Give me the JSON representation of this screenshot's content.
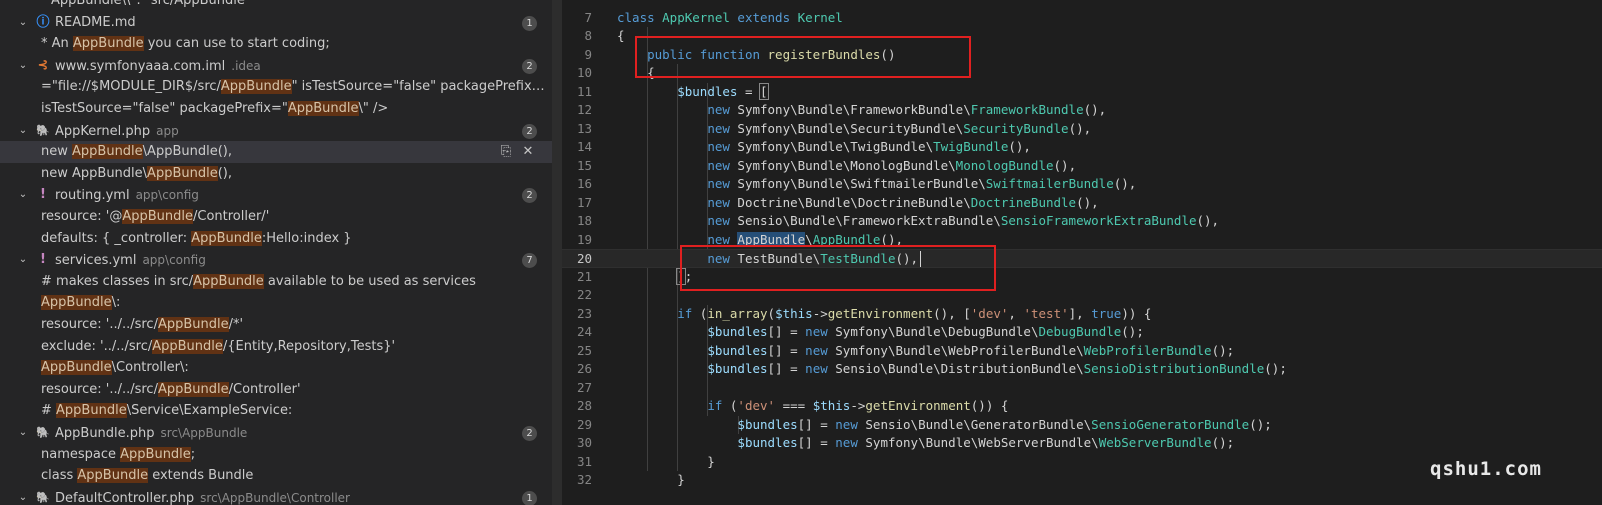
{
  "search_results": {
    "header_line": "\"AppBundle\\\\\": \"src/AppBundle",
    "files": [
      {
        "name": "README.md",
        "path": "",
        "count": "1",
        "icon": "info-icon",
        "icon_glyph": "ⓘ",
        "icon_color": "#3794ff",
        "matches": [
          [
            "* An ",
            "AppBundle",
            " you can use to start coding;"
          ]
        ]
      },
      {
        "name": "www.symfonyaaa.com.iml",
        "path": ".idea",
        "count": "2",
        "icon": "rss-icon",
        "icon_glyph": "⊰",
        "icon_color": "#e37933",
        "matches": [
          [
            "=\"file://$MODULE_DIR$/src/",
            "AppBundle",
            "\" isTestSource=\"false\" packagePrefix=\"AppBundle..."
          ],
          [
            "isTestSource=\"false\" packagePrefix=\"",
            "AppBundle",
            "\\\" />"
          ]
        ]
      },
      {
        "name": "AppKernel.php",
        "path": "app",
        "count": "2",
        "icon": "php-elephant-icon",
        "icon_glyph": "🐘",
        "icon_color": "#a074c4",
        "matches": [
          [
            "new ",
            "AppBundle",
            "\\AppBundle(),"
          ],
          [
            "new AppBundle\\",
            "AppBundle",
            "(),"
          ]
        ]
      },
      {
        "name": "routing.yml",
        "path": "app\\config",
        "count": "2",
        "icon": "yaml-icon",
        "icon_glyph": "!",
        "icon_color": "#c586c0",
        "matches": [
          [
            "resource: '@",
            "AppBundle",
            "/Controller/'"
          ],
          [
            "defaults:  { _controller: ",
            "AppBundle",
            ":Hello:index }"
          ]
        ]
      },
      {
        "name": "services.yml",
        "path": "app\\config",
        "count": "7",
        "icon": "yaml-icon",
        "icon_glyph": "!",
        "icon_color": "#c586c0",
        "matches": [
          [
            "# makes classes in src/",
            "AppBundle",
            " available to be used as services"
          ],
          [
            "",
            "AppBundle",
            "\\:"
          ],
          [
            "resource: '../../src/",
            "AppBundle",
            "/*'"
          ],
          [
            "exclude: '../../src/",
            "AppBundle",
            "/{Entity,Repository,Tests}'"
          ],
          [
            "",
            "AppBundle",
            "\\Controller\\:"
          ],
          [
            "resource: '../../src/",
            "AppBundle",
            "/Controller'"
          ],
          [
            "# ",
            "AppBundle",
            "\\Service\\ExampleService:"
          ]
        ]
      },
      {
        "name": "AppBundle.php",
        "path": "src\\AppBundle",
        "count": "2",
        "icon": "php-elephant-icon",
        "icon_glyph": "🐘",
        "icon_color": "#a074c4",
        "matches": [
          [
            "namespace ",
            "AppBundle",
            ";"
          ],
          [
            "class ",
            "AppBundle",
            " extends Bundle"
          ]
        ]
      },
      {
        "name": "DefaultController.php",
        "path": "src\\AppBundle\\Controller",
        "count": "1",
        "icon": "php-elephant-icon",
        "icon_glyph": "🐘",
        "icon_color": "#a074c4",
        "matches": []
      }
    ],
    "actions": {
      "replace_icon": "replace-icon",
      "dismiss_icon": "close-icon"
    }
  },
  "editor": {
    "current_line": "20",
    "lines": [
      {
        "n": "7",
        "t": [
          [
            "kw",
            "class "
          ],
          [
            "cls",
            "AppKernel "
          ],
          [
            "kw",
            "extends "
          ],
          [
            "cls",
            "Kernel"
          ]
        ]
      },
      {
        "n": "8",
        "t": [
          [
            "tx",
            "{"
          ]
        ]
      },
      {
        "n": "9",
        "t": [
          [
            "tx",
            "    "
          ],
          [
            "kw",
            "public "
          ],
          [
            "kw",
            "function "
          ],
          [
            "fn",
            "registerBundles"
          ],
          [
            "tx",
            "()"
          ]
        ]
      },
      {
        "n": "10",
        "t": [
          [
            "tx",
            "    {"
          ]
        ]
      },
      {
        "n": "11",
        "t": [
          [
            "tx",
            "        "
          ],
          [
            "var",
            "$bundles"
          ],
          [
            "tx",
            " = "
          ],
          [
            "brk",
            "["
          ]
        ]
      },
      {
        "n": "12",
        "t": [
          [
            "tx",
            "            "
          ],
          [
            "kw",
            "new "
          ],
          [
            "tx",
            "Symfony\\Bundle\\FrameworkBundle\\"
          ],
          [
            "cls",
            "FrameworkBundle"
          ],
          [
            "tx",
            "(),"
          ]
        ]
      },
      {
        "n": "13",
        "t": [
          [
            "tx",
            "            "
          ],
          [
            "kw",
            "new "
          ],
          [
            "tx",
            "Symfony\\Bundle\\SecurityBundle\\"
          ],
          [
            "cls",
            "SecurityBundle"
          ],
          [
            "tx",
            "(),"
          ]
        ]
      },
      {
        "n": "14",
        "t": [
          [
            "tx",
            "            "
          ],
          [
            "kw",
            "new "
          ],
          [
            "tx",
            "Symfony\\Bundle\\TwigBundle\\"
          ],
          [
            "cls",
            "TwigBundle"
          ],
          [
            "tx",
            "(),"
          ]
        ]
      },
      {
        "n": "15",
        "t": [
          [
            "tx",
            "            "
          ],
          [
            "kw",
            "new "
          ],
          [
            "tx",
            "Symfony\\Bundle\\MonologBundle\\"
          ],
          [
            "cls",
            "MonologBundle"
          ],
          [
            "tx",
            "(),"
          ]
        ]
      },
      {
        "n": "16",
        "t": [
          [
            "tx",
            "            "
          ],
          [
            "kw",
            "new "
          ],
          [
            "tx",
            "Symfony\\Bundle\\SwiftmailerBundle\\"
          ],
          [
            "cls",
            "SwiftmailerBundle"
          ],
          [
            "tx",
            "(),"
          ]
        ]
      },
      {
        "n": "17",
        "t": [
          [
            "tx",
            "            "
          ],
          [
            "kw",
            "new "
          ],
          [
            "tx",
            "Doctrine\\Bundle\\DoctrineBundle\\"
          ],
          [
            "cls",
            "DoctrineBundle"
          ],
          [
            "tx",
            "(),"
          ]
        ]
      },
      {
        "n": "18",
        "t": [
          [
            "tx",
            "            "
          ],
          [
            "kw",
            "new "
          ],
          [
            "tx",
            "Sensio\\Bundle\\FrameworkExtraBundle\\"
          ],
          [
            "cls",
            "SensioFrameworkExtraBundle"
          ],
          [
            "tx",
            "(),"
          ]
        ]
      },
      {
        "n": "19",
        "t": [
          [
            "tx",
            "            "
          ],
          [
            "kw",
            "new "
          ],
          [
            "sel",
            "AppBundle"
          ],
          [
            "tx",
            "\\"
          ],
          [
            "cls",
            "AppBundle"
          ],
          [
            "tx",
            "(),"
          ]
        ]
      },
      {
        "n": "20",
        "t": [
          [
            "tx",
            "            "
          ],
          [
            "kw",
            "new "
          ],
          [
            "tx",
            "TestBundle\\"
          ],
          [
            "cls",
            "TestBundle"
          ],
          [
            "tx",
            "(),"
          ]
        ]
      },
      {
        "n": "21",
        "t": [
          [
            "tx",
            "        "
          ],
          [
            "brk",
            "]"
          ],
          [
            "tx",
            ";"
          ]
        ]
      },
      {
        "n": "22",
        "t": []
      },
      {
        "n": "23",
        "t": [
          [
            "tx",
            "        "
          ],
          [
            "kw",
            "if "
          ],
          [
            "tx",
            "("
          ],
          [
            "fn",
            "in_array"
          ],
          [
            "tx",
            "("
          ],
          [
            "var",
            "$this"
          ],
          [
            "tx",
            "->"
          ],
          [
            "fn",
            "getEnvironment"
          ],
          [
            "tx",
            "(), ["
          ],
          [
            "str",
            "'dev'"
          ],
          [
            "tx",
            ", "
          ],
          [
            "str",
            "'test'"
          ],
          [
            "tx",
            "], "
          ],
          [
            "kw",
            "true"
          ],
          [
            "tx",
            ")) {"
          ]
        ]
      },
      {
        "n": "24",
        "t": [
          [
            "tx",
            "            "
          ],
          [
            "var",
            "$bundles"
          ],
          [
            "tx",
            "[] = "
          ],
          [
            "kw",
            "new "
          ],
          [
            "tx",
            "Symfony\\Bundle\\DebugBundle\\"
          ],
          [
            "cls",
            "DebugBundle"
          ],
          [
            "tx",
            "();"
          ]
        ]
      },
      {
        "n": "25",
        "t": [
          [
            "tx",
            "            "
          ],
          [
            "var",
            "$bundles"
          ],
          [
            "tx",
            "[] = "
          ],
          [
            "kw",
            "new "
          ],
          [
            "tx",
            "Symfony\\Bundle\\WebProfilerBundle\\"
          ],
          [
            "cls",
            "WebProfilerBundle"
          ],
          [
            "tx",
            "();"
          ]
        ]
      },
      {
        "n": "26",
        "t": [
          [
            "tx",
            "            "
          ],
          [
            "var",
            "$bundles"
          ],
          [
            "tx",
            "[] = "
          ],
          [
            "kw",
            "new "
          ],
          [
            "tx",
            "Sensio\\Bundle\\DistributionBundle\\"
          ],
          [
            "cls",
            "SensioDistributionBundle"
          ],
          [
            "tx",
            "();"
          ]
        ]
      },
      {
        "n": "27",
        "t": []
      },
      {
        "n": "28",
        "t": [
          [
            "tx",
            "            "
          ],
          [
            "kw",
            "if "
          ],
          [
            "tx",
            "("
          ],
          [
            "str",
            "'dev'"
          ],
          [
            "tx",
            " === "
          ],
          [
            "var",
            "$this"
          ],
          [
            "tx",
            "->"
          ],
          [
            "fn",
            "getEnvironment"
          ],
          [
            "tx",
            "()) {"
          ]
        ]
      },
      {
        "n": "29",
        "t": [
          [
            "tx",
            "                "
          ],
          [
            "var",
            "$bundles"
          ],
          [
            "tx",
            "[] = "
          ],
          [
            "kw",
            "new "
          ],
          [
            "tx",
            "Sensio\\Bundle\\GeneratorBundle\\"
          ],
          [
            "cls",
            "SensioGeneratorBundle"
          ],
          [
            "tx",
            "();"
          ]
        ]
      },
      {
        "n": "30",
        "t": [
          [
            "tx",
            "                "
          ],
          [
            "var",
            "$bundles"
          ],
          [
            "tx",
            "[] = "
          ],
          [
            "kw",
            "new "
          ],
          [
            "tx",
            "Symfony\\Bundle\\WebServerBundle\\"
          ],
          [
            "cls",
            "WebServerBundle"
          ],
          [
            "tx",
            "();"
          ]
        ]
      },
      {
        "n": "31",
        "t": [
          [
            "tx",
            "            }"
          ]
        ]
      },
      {
        "n": "32",
        "t": [
          [
            "tx",
            "        }"
          ]
        ]
      }
    ]
  },
  "watermark": "qshu1.com",
  "colors": {
    "highlight": "#613214",
    "annotation_red": "#e02020",
    "accent": "#569cd6"
  }
}
